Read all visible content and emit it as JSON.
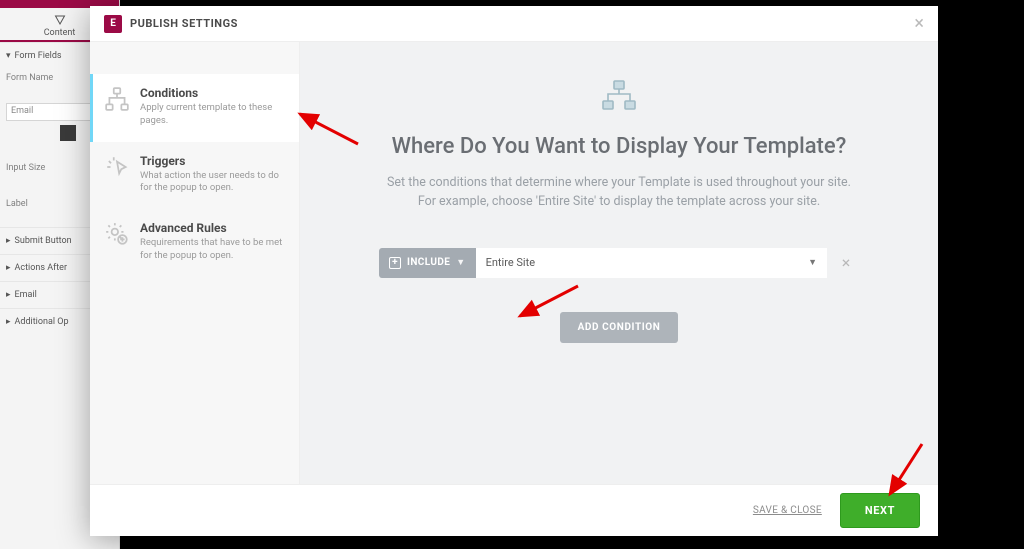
{
  "modal": {
    "title": "PUBLISH SETTINGS",
    "close_glyph": "×"
  },
  "sidebar": {
    "items": [
      {
        "title": "Conditions",
        "desc": "Apply current template to these pages."
      },
      {
        "title": "Triggers",
        "desc": "What action the user needs to do for the popup to open."
      },
      {
        "title": "Advanced Rules",
        "desc": "Requirements that have to be met for the popup to open."
      }
    ]
  },
  "main": {
    "heading": "Where Do You Want to Display Your Template?",
    "sub": "Set the conditions that determine where your Template is used throughout your site. For example, choose 'Entire Site' to display the template across your site.",
    "include_label": "INCLUDE",
    "condition_value": "Entire Site",
    "add_condition_label": "ADD CONDITION"
  },
  "footer": {
    "save_close": "SAVE & CLOSE",
    "next": "NEXT"
  },
  "bg": {
    "tab": "Content",
    "section_form_fields": "Form Fields",
    "label_form_name": "Form Name",
    "input_email": "Email",
    "label_input_size": "Input Size",
    "label_label": "Label",
    "sec_submit": "Submit Button",
    "sec_actions": "Actions After",
    "sec_email": "Email",
    "sec_additional": "Additional Op"
  }
}
